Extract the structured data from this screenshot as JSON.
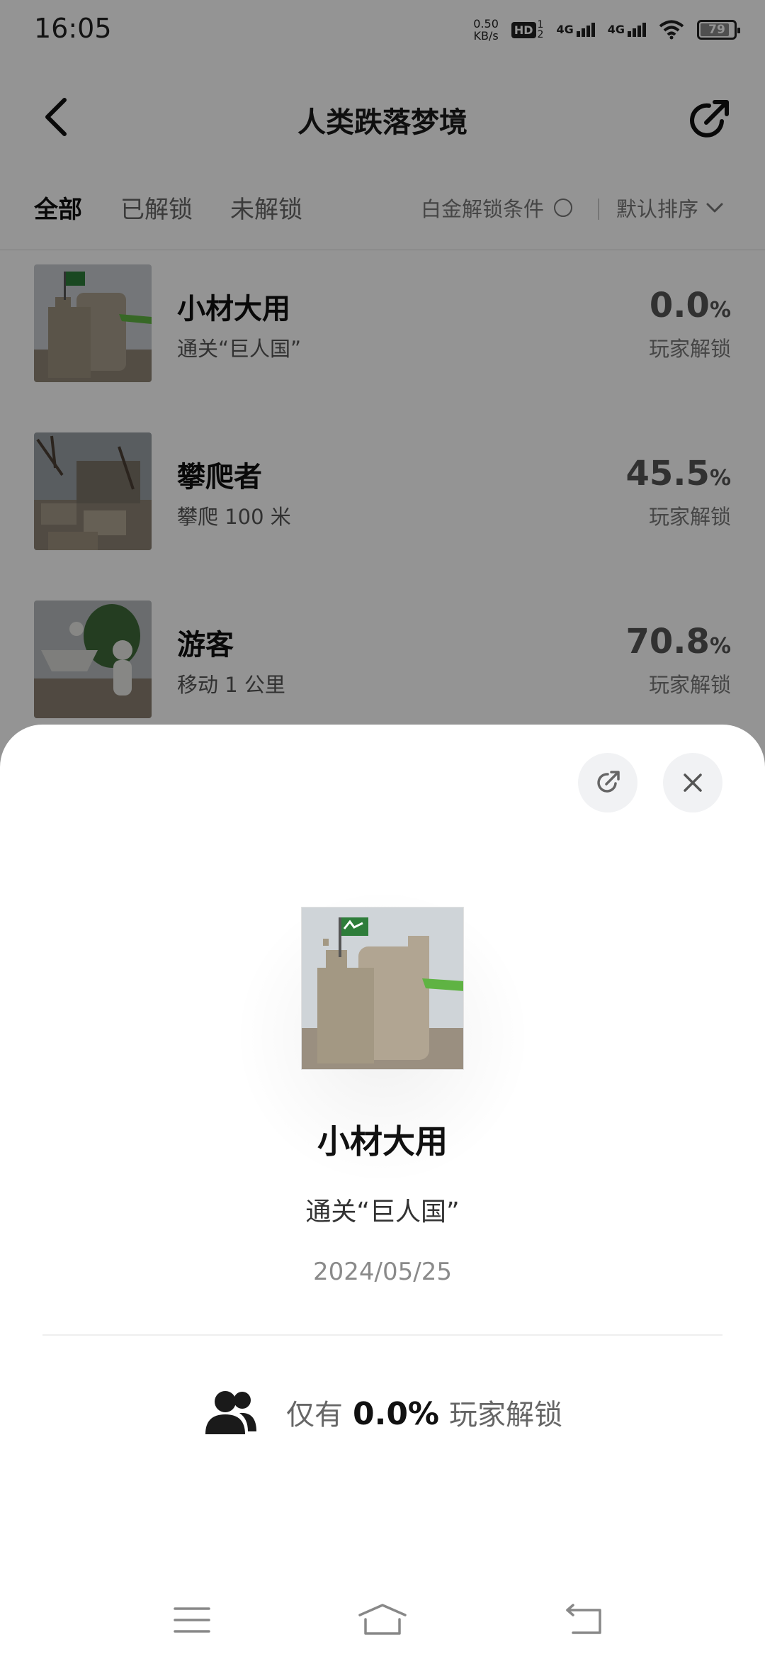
{
  "status_bar": {
    "time": "16:05",
    "net_speed_value": "0.50",
    "net_speed_unit": "KB/s",
    "hd_label": "HD",
    "hd_sim": "1\n2",
    "signal1_label": "4G",
    "signal2_label": "4G",
    "battery_level": "79"
  },
  "header": {
    "title": "人类跌落梦境"
  },
  "filters": {
    "tabs": [
      {
        "label": "全部",
        "active": true
      },
      {
        "label": "已解锁",
        "active": false
      },
      {
        "label": "未解锁",
        "active": false
      }
    ],
    "platinum_condition": "白金解锁条件",
    "sort_label": "默认排序"
  },
  "achievements": [
    {
      "name": "小材大用",
      "desc": "通关“巨人国”",
      "pct": "0.0",
      "pct_sign": "%",
      "pct_label": "玩家解锁"
    },
    {
      "name": "攀爬者",
      "desc": "攀爬 100 米",
      "pct": "45.5",
      "pct_sign": "%",
      "pct_label": "玩家解锁"
    },
    {
      "name": "游客",
      "desc": "移动 1 公里",
      "pct": "70.8",
      "pct_sign": "%",
      "pct_label": "玩家解锁"
    }
  ],
  "detail": {
    "name": "小材大用",
    "desc": "通关“巨人国”",
    "date": "2024/05/25",
    "players_prefix": "仅有",
    "players_pct": "0.0%",
    "players_suffix": "玩家解锁"
  },
  "icons": {
    "back": "chevron-left-icon",
    "share": "share-icon",
    "close": "close-icon",
    "players": "users-icon",
    "sort": "chevron-down-icon"
  },
  "colors": {
    "overlay": "#000000",
    "sheet_bg": "#ffffff",
    "sheet_button_bg": "#f1f2f4",
    "flag_green": "#2e7d3a"
  }
}
